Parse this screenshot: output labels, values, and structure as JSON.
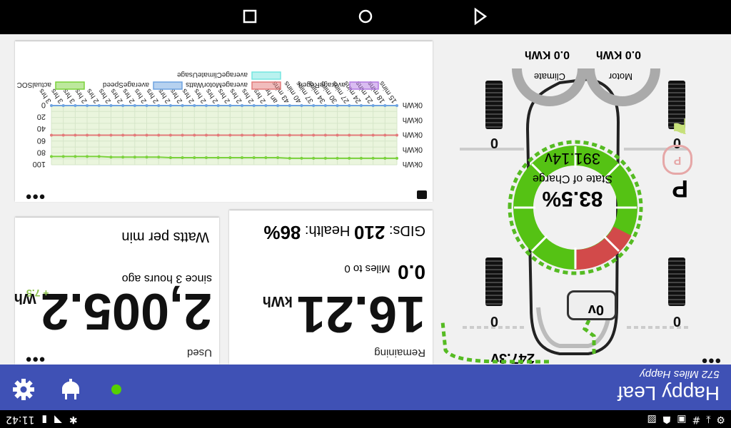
{
  "status_bar": {
    "time": "11:42",
    "icons": [
      "settings-icon",
      "download-icon",
      "hashtag-icon",
      "calendar-icon",
      "android-icon",
      "image-icon",
      "bluetooth-icon",
      "battery-icon",
      "wifi-icon"
    ]
  },
  "app_bar": {
    "title": "Happy Leaf",
    "subtitle": "572 Miles Happy",
    "settings_icon": "settings-icon",
    "plug_icon": "plug-icon",
    "status_color": "#55d000"
  },
  "car": {
    "voltage_12v": "0v",
    "voltage_main": "247.3v",
    "gear": "P",
    "tires": [
      "0",
      "0",
      "0",
      "0"
    ],
    "motor": {
      "label": "Motor",
      "value": "0.0 KWh"
    },
    "climate": {
      "label": "Climate",
      "value": "0.0 KWh"
    },
    "soc": {
      "percent": "83.5%",
      "label": "State of Charge",
      "voltage": "391.14v"
    }
  },
  "remaining": {
    "label": "Remaining",
    "value": "16.21",
    "unit": "kWh",
    "miles": "0.0",
    "miles_label": "Miles to 0",
    "gids_label": "GIDs:",
    "gids": "210",
    "health_label": "Health:",
    "health": "86%"
  },
  "used": {
    "label": "Used",
    "value": "2,005.2",
    "unit": "Wh",
    "delta": "+ 7.5",
    "since": "since 3 hours ago",
    "watts_label": "Watts per min"
  },
  "chart_data": {
    "type": "line",
    "title": "",
    "legend": [
      "actualSOC",
      "averageSpeed",
      "averageMotorWatts",
      "averageRegen",
      "averageClimateUsage"
    ],
    "legend_colors": [
      "#7bd23c",
      "#6ea3e0",
      "#e37a7a",
      "#b37ae3",
      "#74e6e0"
    ],
    "ylabel_ticks": [
      "0",
      "20",
      "40",
      "60",
      "80",
      "100"
    ],
    "right_ticks": [
      "0kWh",
      "0kWh",
      "0kWh",
      "0kWh",
      "0kWh"
    ],
    "categories": [
      "15 mins",
      "18 mins",
      "21 mins",
      "24 mins",
      "27 mins",
      "30 mins",
      "34 mins",
      "37 mins",
      "40 mins",
      "43 mins",
      "an hr",
      "2 hrs",
      "2 hrs",
      "2 hrs",
      "2 hrs",
      "2 hrs",
      "2 hrs",
      "2 hrs",
      "2 hrs",
      "2 hrs",
      "2 hrs",
      "2 hrs",
      "2 hrs",
      "2 hrs",
      "2 hrs",
      "2 hrs",
      "2 hrs",
      "3 hrs",
      "3 hrs",
      "3 hrs"
    ],
    "series": [
      {
        "name": "actualSOC",
        "values": [
          89,
          89,
          89,
          89,
          89,
          89,
          89,
          89,
          89,
          89,
          88,
          88,
          88,
          88,
          88,
          88,
          88,
          88,
          88,
          88,
          87,
          87,
          87,
          87,
          87,
          86,
          86,
          86,
          86,
          86
        ]
      },
      {
        "name": "averageMotorWatts",
        "values": [
          50,
          50,
          50,
          50,
          50,
          50,
          50,
          50,
          50,
          50,
          50,
          50,
          50,
          50,
          50,
          50,
          50,
          50,
          50,
          50,
          50,
          50,
          50,
          50,
          50,
          50,
          50,
          50,
          50,
          50
        ]
      },
      {
        "name": "averageSpeed",
        "values": [
          0,
          0,
          0,
          0,
          0,
          0,
          0,
          0,
          0,
          0,
          0,
          0,
          0,
          0,
          0,
          0,
          0,
          0,
          0,
          0,
          0,
          0,
          0,
          0,
          0,
          0,
          0,
          0,
          0,
          0
        ]
      }
    ],
    "ylim": [
      0,
      100
    ]
  }
}
